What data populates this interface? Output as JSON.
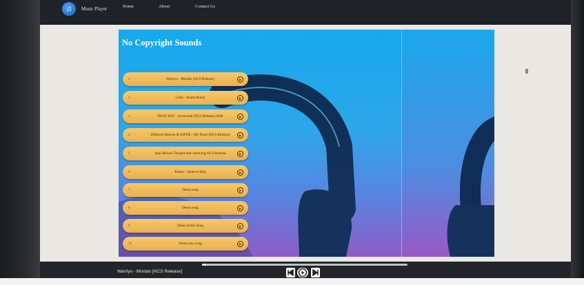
{
  "navbar": {
    "brand": "Music Player",
    "links": [
      "Home",
      "About",
      "Contact Us"
    ]
  },
  "banner": {
    "title": "No Copyright Sounds"
  },
  "songs": [
    {
      "num": "1",
      "title": "Warriyo - Mortals [NCS Release]"
    },
    {
      "num": "2",
      "title": "Cielo - Huma-Huma"
    },
    {
      "num": "3",
      "title": "DEAF KEV - Invincible [NCS Release]-320k"
    },
    {
      "num": "4",
      "title": "Different Heaven & EH!DE - My Heart [NCS Release]"
    },
    {
      "num": "5",
      "title": "Janji-Heroes-Tonight-feat-Johnning-NCS-Release"
    },
    {
      "num": "6",
      "title": "Rabba - Salam-e-Ishq"
    },
    {
      "num": "7",
      "title": "Demo song"
    },
    {
      "num": "8",
      "title": "Demo song"
    },
    {
      "num": "9",
      "title": "Demo Some Song"
    },
    {
      "num": "10",
      "title": "Demo new song"
    }
  ],
  "player": {
    "now_playing": "Warriyo - Mortals [NCS Release]",
    "progress": 0.02
  },
  "icons": {
    "logo": "music-note-icon",
    "song_play": "play-circle-icon",
    "prev": "skip-previous-icon",
    "play": "play-icon",
    "next": "skip-next-icon"
  },
  "colors": {
    "navbar": "#1f2226",
    "banner_top": "#16a8ec",
    "banner_bottom": "#8d5cc6",
    "song_item": "#f0bd5c",
    "player_bar": "#222529"
  }
}
